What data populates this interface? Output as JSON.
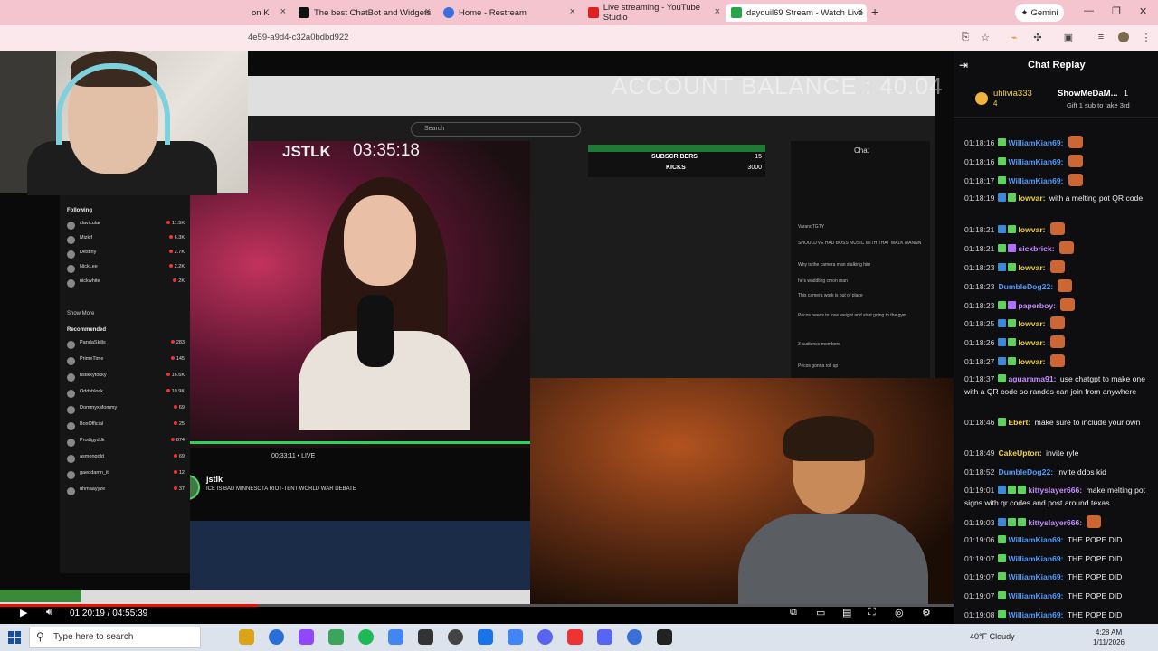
{
  "browser": {
    "tabs": [
      {
        "label": "on K",
        "color": "#4a4a4a"
      },
      {
        "label": "The best ChatBot and Widgets",
        "color": "#111111"
      },
      {
        "label": "Home - Restream",
        "color": "#3b6fe0"
      },
      {
        "label": "Live streaming - YouTube Studio",
        "color": "#e02020"
      },
      {
        "label": "dayquil69 Stream - Watch Live",
        "color": "#2aa34a"
      }
    ],
    "new_tab": "+",
    "gemini_label": "Gemini",
    "url": "4e59-a9d4-c32a0bdbd922"
  },
  "stream": {
    "account_balance": "ACCOUNT BALANCE : 40.04",
    "streamer": "JSTLK",
    "timer": "03:35:18",
    "search_placeholder": "Search",
    "live_time": "00:33:11",
    "live_label": "LIVE",
    "channel_name": "jstlk",
    "channel_desc": "ICE IS BAD MINNESOTA RIOT-TENT WORLD WAR DEBATE",
    "inner_chat_title": "Chat",
    "subscribers_label": "SUBSCRIBERS",
    "kicks_label": "KICKS",
    "subs_value": "15",
    "kicks_value": "3000",
    "inner_chat_lines": [
      "VaranoTGTY",
      "SHOULD'VE HAD BOSS MUSIC WITH THAT WALK MANNN",
      "Why is the camera man stalking him",
      "he's waddling cmon man",
      "This camera work is out of place",
      "Pecos needs to lose weight and start going to the gym",
      "3 audience members",
      "Pecos gonna roll up"
    ]
  },
  "following": {
    "title": "Following",
    "items": [
      {
        "name": "clavicular",
        "sub": "IRL",
        "viewers": "11.5K"
      },
      {
        "name": "Mizkif",
        "sub": "Just Chatting",
        "viewers": "6.3K"
      },
      {
        "name": "Destiny",
        "sub": "ARC Raiders",
        "viewers": "2.7K"
      },
      {
        "name": "NickLee",
        "sub": "IRL",
        "viewers": "2.2K"
      },
      {
        "name": "nickwhite",
        "sub": "IRL",
        "viewers": "2K"
      }
    ],
    "show_more": "Show More",
    "recommended_title": "Recommended",
    "recommended": [
      {
        "name": "PandaSkills",
        "viewers": "283"
      },
      {
        "name": "PrimeTime",
        "viewers": "145"
      },
      {
        "name": "hstikkytokky",
        "viewers": "16.6K"
      },
      {
        "name": "Oddsblock",
        "viewers": "10.9K"
      },
      {
        "name": "DommyxMommy",
        "viewers": "69"
      },
      {
        "name": "BoxOfficial",
        "viewers": "25"
      },
      {
        "name": "Prodigyddk",
        "viewers": "874"
      },
      {
        "name": "asmongold",
        "viewers": "69"
      },
      {
        "name": "gaeddamn_it",
        "viewers": "12"
      },
      {
        "name": "uhmaayyze",
        "viewers": "37"
      }
    ]
  },
  "player": {
    "current_time": "01:20:19",
    "duration": "04:55:39",
    "progress": 0.27
  },
  "chat_replay": {
    "title": "Chat Replay",
    "pinned": {
      "user": "uhlivia333",
      "count": "4",
      "user2": "ShowMeDaM...",
      "n": "1",
      "sub_text": "Gift 1 sub to take 3rd"
    },
    "messages": [
      {
        "ts": "01:18:16",
        "user": "WilliamKian69",
        "color": "#4f9cff",
        "text": "",
        "emote": true,
        "badges": [
          "#5dd35d"
        ]
      },
      {
        "ts": "01:18:16",
        "user": "WilliamKian69",
        "color": "#4f9cff",
        "text": "",
        "emote": true,
        "badges": [
          "#5dd35d"
        ]
      },
      {
        "ts": "01:18:17",
        "user": "WilliamKian69",
        "color": "#4f9cff",
        "text": "",
        "emote": true,
        "badges": [
          "#5dd35d"
        ]
      },
      {
        "ts": "01:18:19",
        "user": "lowvar",
        "color": "#f2d24a",
        "text": "with a melting pot QR code",
        "emote": false,
        "badges": [
          "#3a8ad9",
          "#5dd35d"
        ]
      },
      {
        "ts": "01:18:21",
        "user": "lowvar",
        "color": "#f2d24a",
        "text": "",
        "emote": true,
        "badges": [
          "#3a8ad9",
          "#5dd35d"
        ]
      },
      {
        "ts": "01:18:21",
        "user": "sickbrick",
        "color": "#c58cff",
        "text": "",
        "emote": true,
        "badges": [
          "#5dd35d",
          "#b070ff"
        ]
      },
      {
        "ts": "01:18:23",
        "user": "lowvar",
        "color": "#f2d24a",
        "text": "",
        "emote": true,
        "badges": [
          "#3a8ad9",
          "#5dd35d"
        ]
      },
      {
        "ts": "01:18:23",
        "user": "DumbleDog22",
        "color": "#4f9cff",
        "text": "",
        "emote": true,
        "badges": []
      },
      {
        "ts": "01:18:23",
        "user": "paperboy",
        "color": "#c58cff",
        "text": "",
        "emote": true,
        "badges": [
          "#5dd35d",
          "#b070ff"
        ]
      },
      {
        "ts": "01:18:25",
        "user": "lowvar",
        "color": "#f2d24a",
        "text": "",
        "emote": true,
        "badges": [
          "#3a8ad9",
          "#5dd35d"
        ]
      },
      {
        "ts": "01:18:26",
        "user": "lowvar",
        "color": "#f2d24a",
        "text": "",
        "emote": true,
        "badges": [
          "#3a8ad9",
          "#5dd35d"
        ]
      },
      {
        "ts": "01:18:27",
        "user": "lowvar",
        "color": "#f2d24a",
        "text": "",
        "emote": true,
        "badges": [
          "#3a8ad9",
          "#5dd35d"
        ]
      },
      {
        "ts": "01:18:37",
        "user": "aguarama91",
        "color": "#c58cff",
        "text": "use chatgpt to make one with a QR code so randos can join from anywhere",
        "emote": false,
        "badges": [
          "#5dd35d"
        ]
      },
      {
        "ts": "01:18:46",
        "user": "Ebert",
        "color": "#f2d24a",
        "text": "make sure to include your own",
        "emote": false,
        "badges": [
          "#5dd35d"
        ]
      },
      {
        "ts": "01:18:49",
        "user": "CakeUpton",
        "color": "#f2d24a",
        "text": "invite ryle",
        "emote": false,
        "badges": []
      },
      {
        "ts": "01:18:52",
        "user": "DumbleDog22",
        "color": "#4f9cff",
        "text": "invite ddos kid",
        "emote": false,
        "badges": []
      },
      {
        "ts": "01:19:01",
        "user": "kittyslayer666",
        "color": "#c58cff",
        "text": "make melting pot signs with qr codes and post around texas",
        "emote": false,
        "badges": [
          "#3a8ad9",
          "#5dd35d",
          "#5dd35d"
        ]
      },
      {
        "ts": "01:19:03",
        "user": "kittyslayer666",
        "color": "#c58cff",
        "text": "",
        "emote": true,
        "badges": [
          "#3a8ad9",
          "#5dd35d",
          "#5dd35d"
        ]
      },
      {
        "ts": "01:19:06",
        "user": "WilliamKian69",
        "color": "#4f9cff",
        "text": "THE POPE DID",
        "emote": false,
        "badges": [
          "#5dd35d"
        ]
      },
      {
        "ts": "01:19:07",
        "user": "WilliamKian69",
        "color": "#4f9cff",
        "text": "THE POPE DID",
        "emote": false,
        "badges": [
          "#5dd35d"
        ]
      },
      {
        "ts": "01:19:07",
        "user": "WilliamKian69",
        "color": "#4f9cff",
        "text": "THE POPE DID",
        "emote": false,
        "badges": [
          "#5dd35d"
        ]
      },
      {
        "ts": "01:19:07",
        "user": "WilliamKian69",
        "color": "#4f9cff",
        "text": "THE POPE DID",
        "emote": false,
        "badges": [
          "#5dd35d"
        ]
      },
      {
        "ts": "01:19:08",
        "user": "WilliamKian69",
        "color": "#4f9cff",
        "text": "THE POPE DID",
        "emote": false,
        "badges": [
          "#5dd35d"
        ]
      }
    ]
  },
  "taskbar": {
    "search_placeholder": "Type here to search",
    "weather": "40°F Cloudy",
    "time": "4:28 AM",
    "date": "1/11/2026",
    "app_colors": [
      "#d9a31a",
      "#2b6fd6",
      "#9146ff",
      "#3ba55c",
      "#1db954",
      "#4285f4",
      "#333333",
      "#444444",
      "#1a73e8",
      "#4285f4",
      "#5865f2",
      "#e33",
      "#5865f2",
      "#3a6fd8",
      "#222222"
    ]
  }
}
